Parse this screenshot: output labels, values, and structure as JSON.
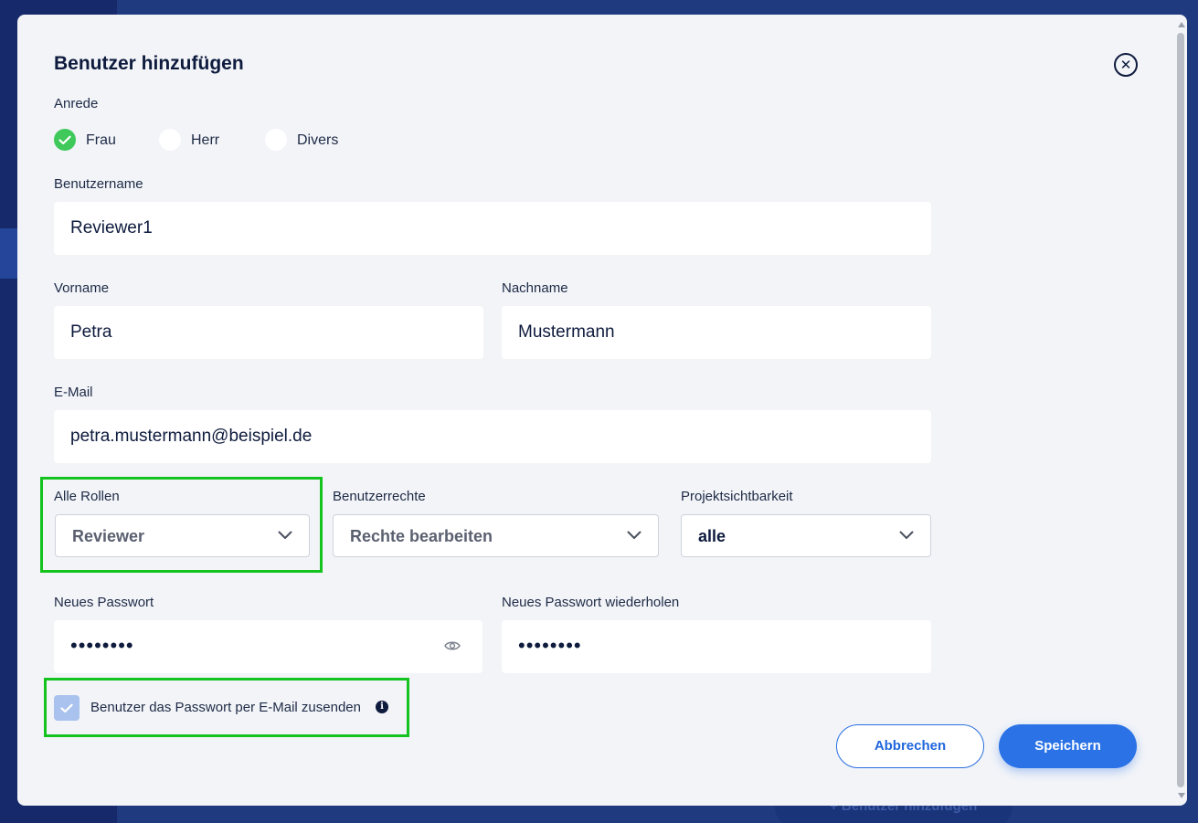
{
  "background": {
    "button_label": "+ Benutzer hinzufügen"
  },
  "modal": {
    "title": "Benutzer hinzufügen",
    "salutation": {
      "label": "Anrede",
      "options": [
        "Frau",
        "Herr",
        "Divers"
      ],
      "selected": "Frau"
    },
    "username": {
      "label": "Benutzername",
      "value": "Reviewer1"
    },
    "firstname": {
      "label": "Vorname",
      "value": "Petra"
    },
    "lastname": {
      "label": "Nachname",
      "value": "Mustermann"
    },
    "email": {
      "label": "E-Mail",
      "value": "petra.mustermann@beispiel.de"
    },
    "roles": {
      "label": "Alle Rollen",
      "value": "Reviewer"
    },
    "rights": {
      "label": "Benutzerrechte",
      "value": "Rechte bearbeiten"
    },
    "visibility": {
      "label": "Projektsichtbarkeit",
      "value": "alle"
    },
    "password": {
      "label": "Neues Passwort",
      "value": "••••••••"
    },
    "password_repeat": {
      "label": "Neues Passwort wiederholen",
      "value": "••••••••"
    },
    "send_password": {
      "label": "Benutzer das Passwort per E-Mail zusenden",
      "checked": true
    },
    "cancel_label": "Abbrechen",
    "save_label": "Speichern"
  },
  "colors": {
    "accent": "#2a72e6",
    "radio_checked": "#3fc95b",
    "highlight": "#14c31e",
    "text": "#0e1b3d"
  }
}
